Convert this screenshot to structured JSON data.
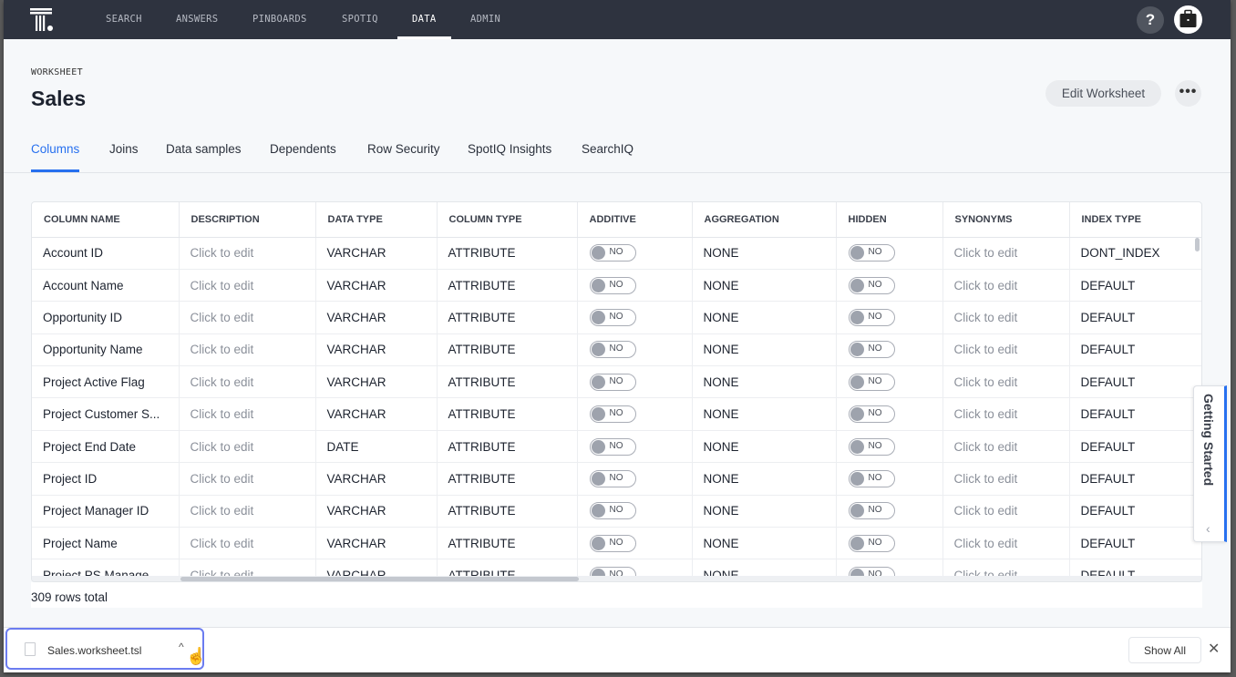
{
  "nav": {
    "items": [
      {
        "label": "SEARCH",
        "active": false
      },
      {
        "label": "ANSWERS",
        "active": false
      },
      {
        "label": "PINBOARDS",
        "active": false
      },
      {
        "label": "SPOTIQ",
        "active": false
      },
      {
        "label": "DATA",
        "active": true
      },
      {
        "label": "ADMIN",
        "active": false
      }
    ],
    "help_label": "?",
    "logo_icon": "thoughtspot-logo-icon",
    "avatar_icon": "briefcase-icon"
  },
  "header": {
    "breadcrumb": "WORKSHEET",
    "title": "Sales",
    "edit_button": "Edit Worksheet",
    "more_button": "•••"
  },
  "tabs": [
    {
      "label": "Columns",
      "active": true
    },
    {
      "label": "Joins",
      "active": false
    },
    {
      "label": "Data samples",
      "active": false
    },
    {
      "label": "Dependents",
      "active": false
    },
    {
      "label": "Row Security",
      "active": false
    },
    {
      "label": "SpotIQ Insights",
      "active": false
    },
    {
      "label": "SearchIQ",
      "active": false
    }
  ],
  "table": {
    "headers": [
      "COLUMN NAME",
      "DESCRIPTION",
      "DATA TYPE",
      "COLUMN TYPE",
      "ADDITIVE",
      "AGGREGATION",
      "HIDDEN",
      "SYNONYMS",
      "INDEX TYPE"
    ],
    "rows": [
      {
        "name": "Account ID",
        "description": "Click to edit",
        "data_type": "VARCHAR",
        "column_type": "ATTRIBUTE",
        "additive": "NO",
        "aggregation": "NONE",
        "hidden": "NO",
        "synonyms": "Click to edit",
        "index_type": "DONT_INDEX"
      },
      {
        "name": "Account Name",
        "description": "Click to edit",
        "data_type": "VARCHAR",
        "column_type": "ATTRIBUTE",
        "additive": "NO",
        "aggregation": "NONE",
        "hidden": "NO",
        "synonyms": "Click to edit",
        "index_type": "DEFAULT"
      },
      {
        "name": "Opportunity ID",
        "description": "Click to edit",
        "data_type": "VARCHAR",
        "column_type": "ATTRIBUTE",
        "additive": "NO",
        "aggregation": "NONE",
        "hidden": "NO",
        "synonyms": "Click to edit",
        "index_type": "DEFAULT"
      },
      {
        "name": "Opportunity Name",
        "description": "Click to edit",
        "data_type": "VARCHAR",
        "column_type": "ATTRIBUTE",
        "additive": "NO",
        "aggregation": "NONE",
        "hidden": "NO",
        "synonyms": "Click to edit",
        "index_type": "DEFAULT"
      },
      {
        "name": "Project Active Flag",
        "description": "Click to edit",
        "data_type": "VARCHAR",
        "column_type": "ATTRIBUTE",
        "additive": "NO",
        "aggregation": "NONE",
        "hidden": "NO",
        "synonyms": "Click to edit",
        "index_type": "DEFAULT"
      },
      {
        "name": "Project Customer S...",
        "description": "Click to edit",
        "data_type": "VARCHAR",
        "column_type": "ATTRIBUTE",
        "additive": "NO",
        "aggregation": "NONE",
        "hidden": "NO",
        "synonyms": "Click to edit",
        "index_type": "DEFAULT"
      },
      {
        "name": "Project End Date",
        "description": "Click to edit",
        "data_type": "DATE",
        "column_type": "ATTRIBUTE",
        "additive": "NO",
        "aggregation": "NONE",
        "hidden": "NO",
        "synonyms": "Click to edit",
        "index_type": "DEFAULT"
      },
      {
        "name": "Project ID",
        "description": "Click to edit",
        "data_type": "VARCHAR",
        "column_type": "ATTRIBUTE",
        "additive": "NO",
        "aggregation": "NONE",
        "hidden": "NO",
        "synonyms": "Click to edit",
        "index_type": "DEFAULT"
      },
      {
        "name": "Project Manager ID",
        "description": "Click to edit",
        "data_type": "VARCHAR",
        "column_type": "ATTRIBUTE",
        "additive": "NO",
        "aggregation": "NONE",
        "hidden": "NO",
        "synonyms": "Click to edit",
        "index_type": "DEFAULT"
      },
      {
        "name": "Project Name",
        "description": "Click to edit",
        "data_type": "VARCHAR",
        "column_type": "ATTRIBUTE",
        "additive": "NO",
        "aggregation": "NONE",
        "hidden": "NO",
        "synonyms": "Click to edit",
        "index_type": "DEFAULT"
      },
      {
        "name": "Project PS Manage",
        "description": "Click to edit",
        "data_type": "VARCHAR",
        "column_type": "ATTRIBUTE",
        "additive": "NO",
        "aggregation": "NONE",
        "hidden": "NO",
        "synonyms": "Click to edit",
        "index_type": "DEFAULT"
      }
    ],
    "rows_total": "309 rows total"
  },
  "getting_started": {
    "label": "Getting Started",
    "chevron": "‹"
  },
  "downloads": {
    "file_name": "Sales.worksheet.tsl",
    "caret": "^",
    "show_all": "Show All",
    "close": "✕"
  },
  "colors": {
    "nav_bg": "#2e333f",
    "accent": "#2770ef",
    "download_highlight": "#6b7cf0"
  }
}
